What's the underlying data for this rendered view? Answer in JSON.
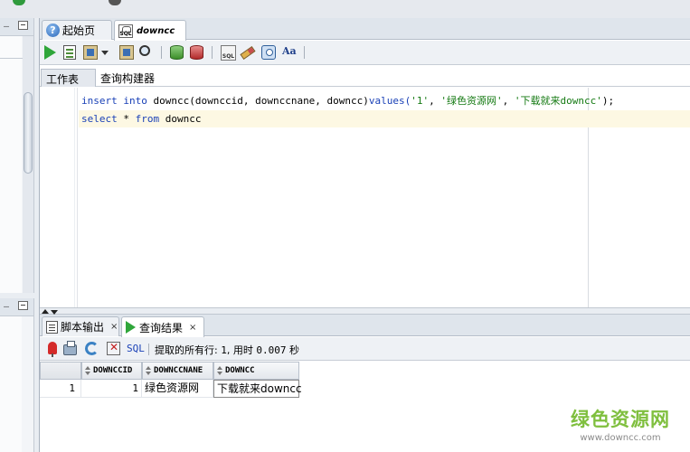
{
  "doc_tabs": [
    {
      "label": "起始页"
    },
    {
      "label": "downcc"
    }
  ],
  "editor_tabs": {
    "worksheet": "工作表",
    "query_builder": "查询构建器"
  },
  "editor": {
    "line1": {
      "kw_insert": "insert",
      "kw_into": "into",
      "table": "downcc(downccid, downccnane, downcc)",
      "kw_values": "values(",
      "v1": "'1'",
      "sep1": ", ",
      "v2": "'绿色资源网'",
      "sep2": ", ",
      "v3": "'下载就来downcc'",
      "end": ");"
    },
    "line2": {
      "kw_select": "select",
      "star": "*",
      "kw_from": "from",
      "table": "downcc"
    }
  },
  "result_tabs": [
    {
      "label": "脚本输出",
      "close": "×"
    },
    {
      "label": "查询结果",
      "close": "×"
    }
  ],
  "result_toolbar": {
    "sql_label": "SQL",
    "status_prefix": "提取的所有行:",
    "rows_fetched": "1",
    "time_label": ", 用时",
    "time_value": "0.007",
    "time_unit": "秒"
  },
  "results": {
    "columns": [
      "DOWNCCID",
      "DOWNCCNANE",
      "DOWNCC"
    ],
    "rows": [
      {
        "rownum": "1",
        "downccid": "1",
        "downccnane": "绿色资源网",
        "downcc": "下载就来downcc"
      }
    ]
  },
  "watermark": {
    "title": "绿色资源网",
    "url": "www.downcc.com"
  },
  "colors": {
    "keyword": "#1a41b7",
    "string": "#157a13",
    "run_green": "#2fa63a",
    "watermark_green": "#7fbf3e"
  }
}
